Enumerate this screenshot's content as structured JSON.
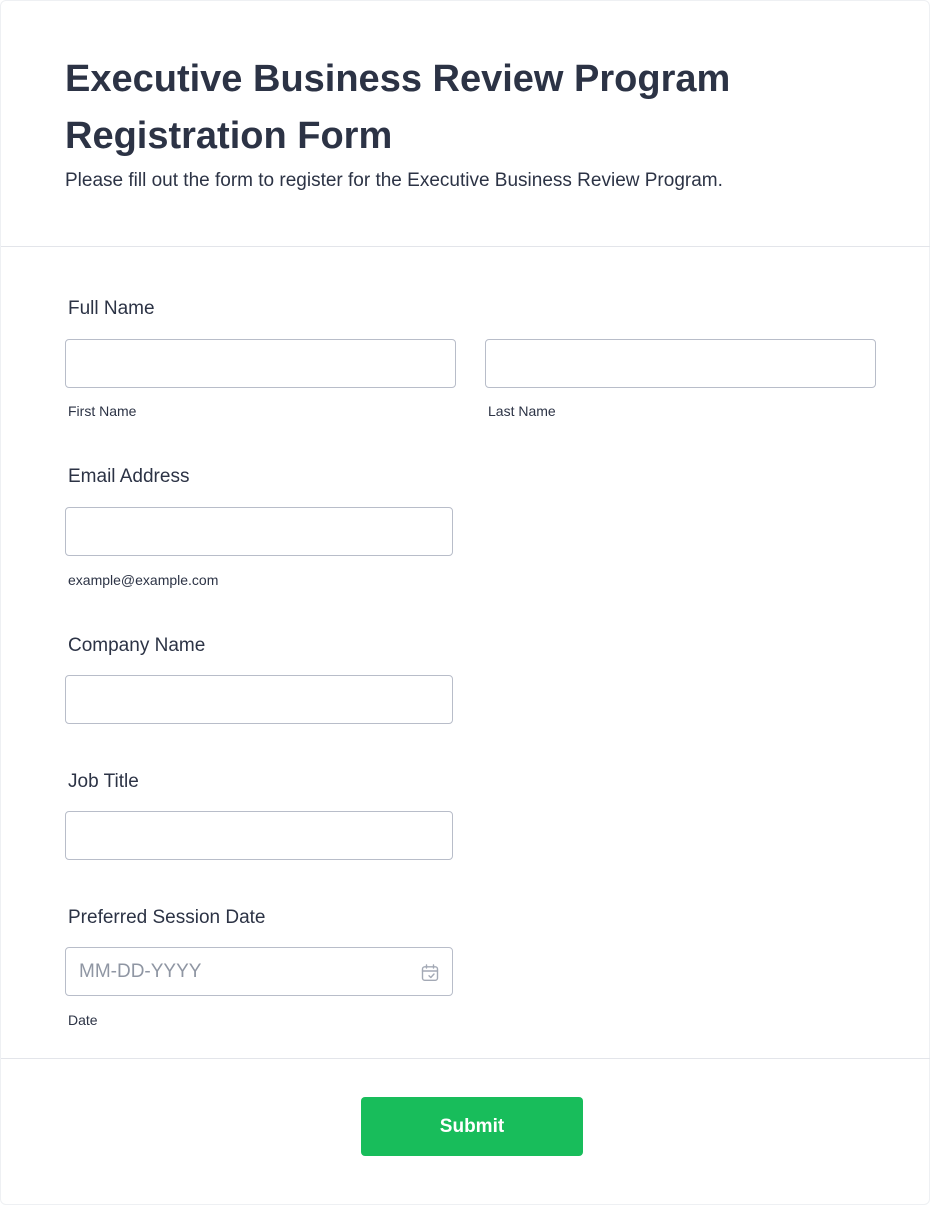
{
  "form": {
    "title": "Executive Business Review Program Registration Form",
    "subtitle": "Please fill out the form to register for the Executive Business Review Program."
  },
  "fields": {
    "full_name": {
      "label": "Full Name",
      "first_sublabel": "First Name",
      "last_sublabel": "Last Name",
      "first_value": "",
      "last_value": ""
    },
    "email": {
      "label": "Email Address",
      "sublabel": "example@example.com",
      "value": ""
    },
    "company": {
      "label": "Company Name",
      "value": ""
    },
    "job_title": {
      "label": "Job Title",
      "value": ""
    },
    "session_date": {
      "label": "Preferred Session Date",
      "placeholder": "MM-DD-YYYY",
      "sublabel": "Date",
      "value": "",
      "icon": "calendar-icon"
    }
  },
  "actions": {
    "submit_label": "Submit"
  },
  "colors": {
    "submit_bg": "#18bd5b",
    "text": "#2c3345",
    "input_border": "#b8bdc9",
    "divider": "#e3e5ea"
  }
}
